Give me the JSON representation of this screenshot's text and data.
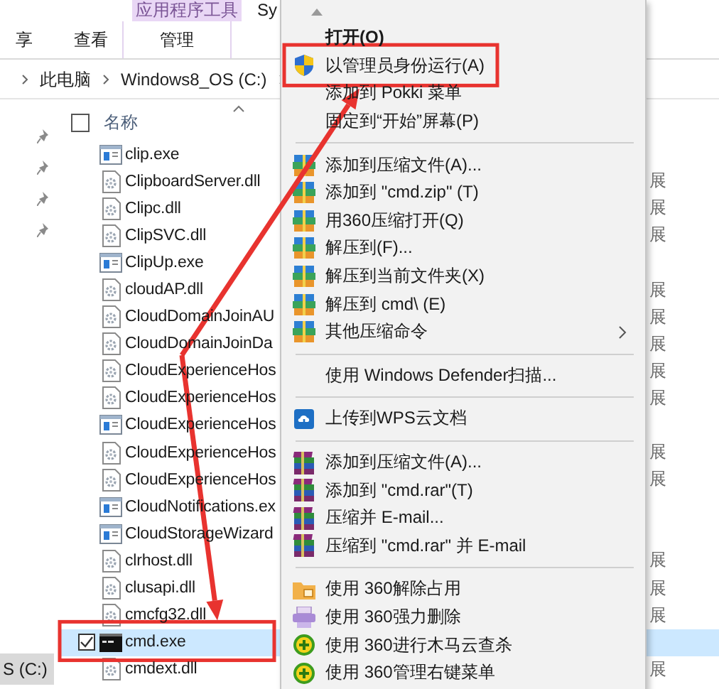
{
  "window": {
    "title": "Sy"
  },
  "ribbon": {
    "context_group": "应用程序工具",
    "tabs": [
      {
        "label": "享",
        "context": false
      },
      {
        "label": "查看",
        "context": false
      },
      {
        "label": "管理",
        "context": true
      }
    ]
  },
  "address": {
    "crumbs": [
      "此电脑",
      "Windows8_OS (C:)"
    ]
  },
  "nav": {
    "items": [
      {
        "label": "S (C:)",
        "selected": true
      }
    ]
  },
  "list": {
    "column": "名称",
    "select_all_checked": false,
    "rows": [
      {
        "name": "clip.exe",
        "kind": "exe",
        "selected": false,
        "checked": false
      },
      {
        "name": "ClipboardServer.dll",
        "kind": "dll",
        "type": "展",
        "selected": false,
        "checked": false
      },
      {
        "name": "Clipc.dll",
        "kind": "dll",
        "type": "展",
        "selected": false,
        "checked": false
      },
      {
        "name": "ClipSVC.dll",
        "kind": "dll",
        "type": "展",
        "selected": false,
        "checked": false
      },
      {
        "name": "ClipUp.exe",
        "kind": "exe",
        "selected": false,
        "checked": false
      },
      {
        "name": "cloudAP.dll",
        "kind": "dll",
        "type": "展",
        "selected": false,
        "checked": false
      },
      {
        "name": "CloudDomainJoinAU",
        "kind": "dll",
        "type": "展",
        "selected": false,
        "checked": false
      },
      {
        "name": "CloudDomainJoinDa",
        "kind": "dll",
        "type": "展",
        "selected": false,
        "checked": false
      },
      {
        "name": "CloudExperienceHos",
        "kind": "dll",
        "type": "展",
        "selected": false,
        "checked": false
      },
      {
        "name": "CloudExperienceHos",
        "kind": "dll",
        "type": "展",
        "selected": false,
        "checked": false
      },
      {
        "name": "CloudExperienceHos",
        "kind": "exe",
        "selected": false,
        "checked": false
      },
      {
        "name": "CloudExperienceHos",
        "kind": "dll",
        "type": "展",
        "selected": false,
        "checked": false
      },
      {
        "name": "CloudExperienceHos",
        "kind": "dll",
        "type": "展",
        "selected": false,
        "checked": false
      },
      {
        "name": "CloudNotifications.ex",
        "kind": "exe",
        "selected": false,
        "checked": false
      },
      {
        "name": "CloudStorageWizard",
        "kind": "exe",
        "selected": false,
        "checked": false
      },
      {
        "name": "clrhost.dll",
        "kind": "dll",
        "type": "展",
        "selected": false,
        "checked": false
      },
      {
        "name": "clusapi.dll",
        "kind": "dll",
        "type": "展",
        "selected": false,
        "checked": false
      },
      {
        "name": "cmcfg32.dll",
        "kind": "dll",
        "type": "展",
        "selected": false,
        "checked": false
      },
      {
        "name": "cmd.exe",
        "kind": "cmd",
        "selected": true,
        "checked": true,
        "annotated": true
      },
      {
        "name": "cmdext.dll",
        "kind": "dll",
        "type": "展",
        "selected": false,
        "checked": false
      }
    ]
  },
  "context_menu": {
    "items": [
      {
        "kind": "default",
        "label": "打开(O)"
      },
      {
        "kind": "shield",
        "label": "以管理员身份运行(A)",
        "annotated": true
      },
      {
        "kind": "plain",
        "label": "添加到 Pokki 菜单"
      },
      {
        "kind": "plain",
        "label": "固定到“开始”屏幕(P)"
      },
      {
        "kind": "separator"
      },
      {
        "kind": "zip",
        "label": "添加到压缩文件(A)..."
      },
      {
        "kind": "zip",
        "label": "添加到 \"cmd.zip\" (T)"
      },
      {
        "kind": "zip",
        "label": "用360压缩打开(Q)"
      },
      {
        "kind": "zip",
        "label": "解压到(F)..."
      },
      {
        "kind": "zip",
        "label": "解压到当前文件夹(X)"
      },
      {
        "kind": "zip",
        "label": "解压到 cmd\\ (E)"
      },
      {
        "kind": "zip",
        "label": "其他压缩命令",
        "submenu": true
      },
      {
        "kind": "separator"
      },
      {
        "kind": "plain",
        "label": "使用 Windows Defender扫描..."
      },
      {
        "kind": "separator"
      },
      {
        "kind": "cloud",
        "label": "上传到WPS云文档"
      },
      {
        "kind": "separator"
      },
      {
        "kind": "rar",
        "label": "添加到压缩文件(A)..."
      },
      {
        "kind": "rar",
        "label": "添加到 \"cmd.rar\"(T)"
      },
      {
        "kind": "rar",
        "label": "压缩并 E-mail..."
      },
      {
        "kind": "rar",
        "label": "压缩到 \"cmd.rar\" 并 E-mail"
      },
      {
        "kind": "separator"
      },
      {
        "kind": "unlock",
        "label": "使用 360解除占用"
      },
      {
        "kind": "shred",
        "label": "使用 360强力删除"
      },
      {
        "kind": "plus360",
        "label": "使用 360进行木马云查杀"
      },
      {
        "kind": "plus360",
        "label": "使用 360管理右键菜单"
      }
    ]
  }
}
